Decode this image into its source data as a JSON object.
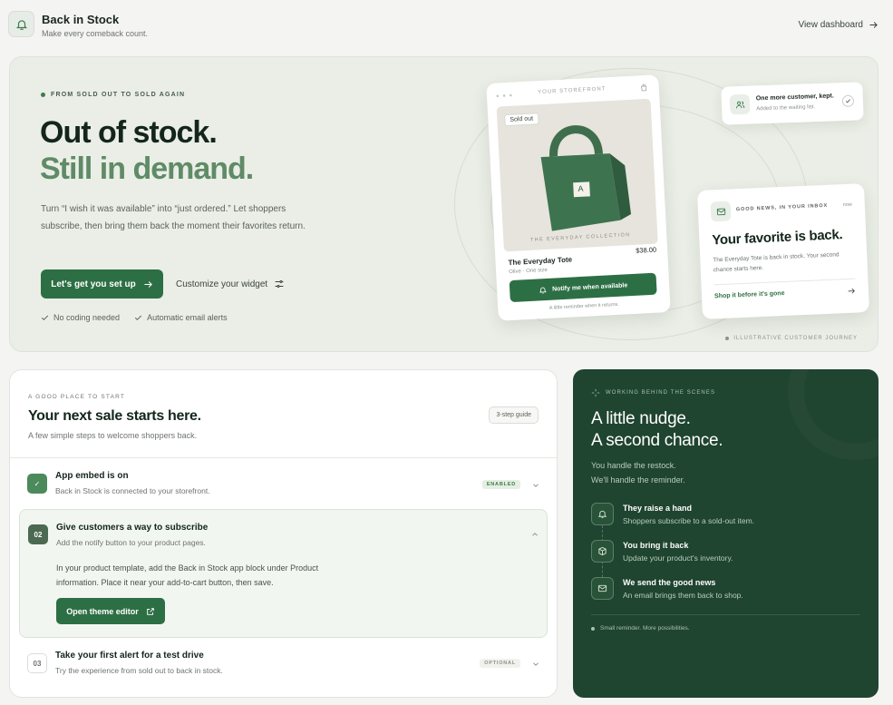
{
  "header": {
    "icon": "bell-icon",
    "title": "Back in Stock",
    "subtitle": "Make every comeback count.",
    "view_dashboard": "View dashboard"
  },
  "hero": {
    "eyebrow": "FROM SOLD OUT TO SOLD AGAIN",
    "headline_1": "Out of stock.",
    "headline_2": "Still in demand.",
    "description": "Turn “I wish it was available” into “just ordered.” Let shoppers subscribe, then bring them back the moment their favorites return.",
    "primary_cta": "Let's get you set up",
    "secondary_cta": "Customize your widget",
    "checks": [
      "No coding needed",
      "Automatic email alerts"
    ],
    "illustrative_note": "ILLUSTRATIVE CUSTOMER JOURNEY",
    "storefront": {
      "label": "YOUR STOREFRONT",
      "sold_out": "Sold out",
      "bag_letter": "A",
      "collection": "THE EVERYDAY COLLECTION",
      "product_name": "The Everyday Tote",
      "price": "$38.00",
      "variant": "Olive · One size",
      "notify_button": "Notify me when available",
      "footnote": "A little reminder when it returns."
    },
    "notification": {
      "title": "One more customer, kept.",
      "subtitle": "Added to the waiting list."
    },
    "email": {
      "eyebrow": "GOOD NEWS, IN YOUR INBOX",
      "time": "now",
      "title": "Your favorite is back.",
      "body": "The Everyday Tote is back in stock. Your second chance starts here.",
      "link": "Shop it before it's gone"
    }
  },
  "setup": {
    "eyebrow": "A GOOD PLACE TO START",
    "title": "Your next sale starts here.",
    "subtitle": "A few simple steps to welcome shoppers back.",
    "badge": "3-step guide",
    "steps": [
      {
        "num": "✓",
        "title": "App embed is on",
        "desc": "Back in Stock is connected to your storefront.",
        "tag": "ENABLED"
      },
      {
        "num": "02",
        "title": "Give customers a way to subscribe",
        "desc": "Add the notify button to your product pages.",
        "body": "In your product template, add the Back in Stock app block under Product information. Place it near your add-to-cart button, then save.",
        "button": "Open theme editor"
      },
      {
        "num": "03",
        "title": "Take your first alert for a test drive",
        "desc": "Try the experience from sold out to back in stock.",
        "tag": "OPTIONAL"
      }
    ]
  },
  "behind": {
    "eyebrow": "WORKING BEHIND THE SCENES",
    "headline_1": "A little nudge.",
    "headline_2": "A second chance.",
    "sub_1": "You handle the restock.",
    "sub_2": "We'll handle the reminder.",
    "items": [
      {
        "icon": "bell-icon",
        "title": "They raise a hand",
        "desc": "Shoppers subscribe to a sold-out item."
      },
      {
        "icon": "box-icon",
        "title": "You bring it back",
        "desc": "Update your product's inventory."
      },
      {
        "icon": "mail-icon",
        "title": "We send the good news",
        "desc": "An email brings them back to shop."
      }
    ],
    "footer": "Small reminder. More possibilities."
  },
  "colors": {
    "brand": "#2d6f44",
    "dark_panel": "#1f4430",
    "accent_light": "#5f8b67"
  }
}
